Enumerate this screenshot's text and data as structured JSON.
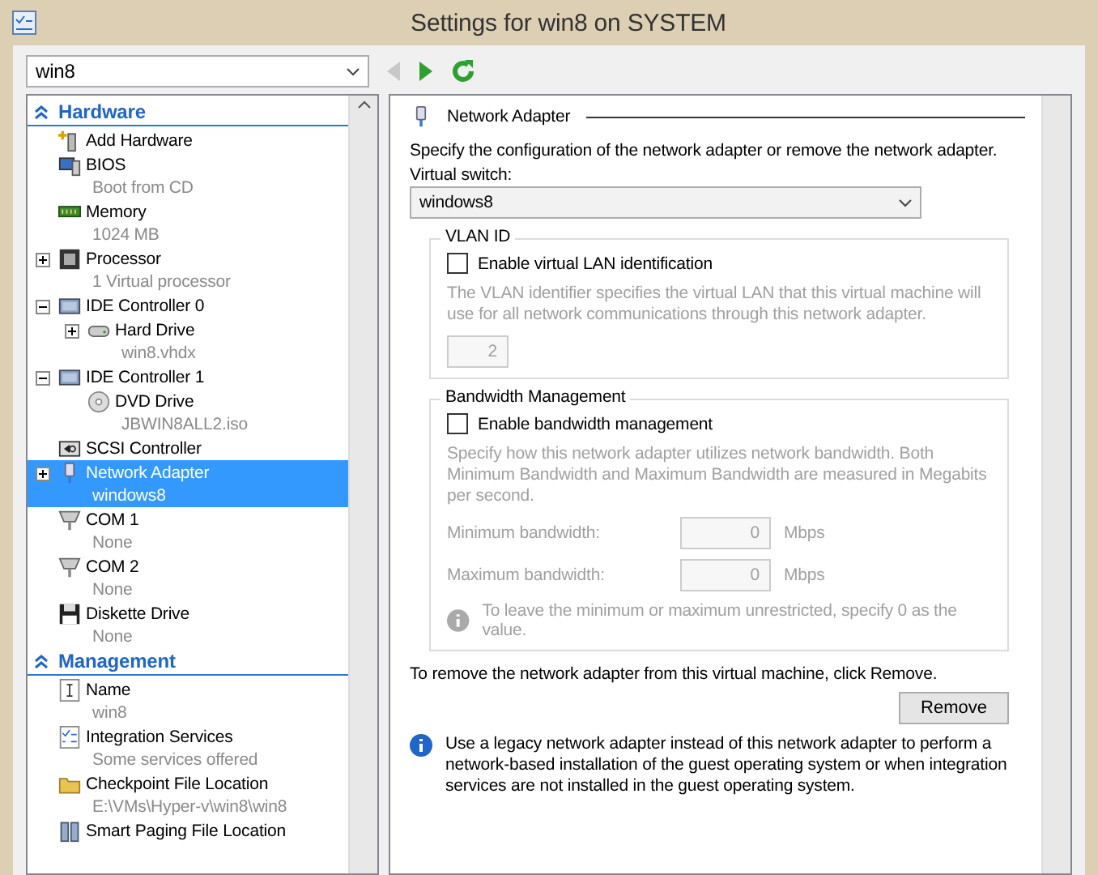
{
  "window": {
    "title": "Settings for win8 on SYSTEM"
  },
  "vm_selector": {
    "value": "win8"
  },
  "navigation": {
    "back": {
      "disabled": true
    },
    "forward": {
      "disabled": false
    }
  },
  "tree": {
    "sections": [
      {
        "title": "Hardware",
        "expanded": true,
        "items": [
          {
            "kind": "add",
            "name": "Add Hardware",
            "selected": false
          },
          {
            "kind": "bios",
            "name": "BIOS",
            "sub": "Boot from CD",
            "selected": false
          },
          {
            "kind": "memory",
            "name": "Memory",
            "sub": "1024 MB",
            "selected": false
          },
          {
            "kind": "processor",
            "name": "Processor",
            "sub": "1 Virtual processor",
            "expanded": false,
            "selected": false
          },
          {
            "kind": "controller",
            "name": "IDE Controller 0",
            "expanded": true,
            "selected": false,
            "children": [
              {
                "kind": "disk",
                "name": "Hard Drive",
                "sub": "win8.vhdx",
                "expanded": false,
                "selected": false
              }
            ]
          },
          {
            "kind": "controller",
            "name": "IDE Controller 1",
            "expanded": true,
            "selected": false,
            "children": [
              {
                "kind": "dvd",
                "name": "DVD Drive",
                "sub": "JBWIN8ALL2.iso",
                "selected": false
              }
            ]
          },
          {
            "kind": "scsi",
            "name": "SCSI Controller",
            "selected": false
          },
          {
            "kind": "network",
            "name": "Network Adapter",
            "sub": "windows8",
            "expanded": false,
            "selected": true
          },
          {
            "kind": "port",
            "name": "COM 1",
            "sub": "None",
            "selected": false
          },
          {
            "kind": "port",
            "name": "COM 2",
            "sub": "None",
            "selected": false
          },
          {
            "kind": "floppy",
            "name": "Diskette Drive",
            "sub": "None",
            "selected": false
          }
        ]
      },
      {
        "title": "Management",
        "expanded": true,
        "items": [
          {
            "kind": "name",
            "name": "Name",
            "sub": "win8",
            "selected": false
          },
          {
            "kind": "services",
            "name": "Integration Services",
            "sub": "Some services offered",
            "selected": false
          },
          {
            "kind": "folder",
            "name": "Checkpoint File Location",
            "sub": "E:\\VMs\\Hyper-v\\win8\\win8",
            "selected": false
          },
          {
            "kind": "paging",
            "name": "Smart Paging File Location",
            "selected": false
          }
        ]
      }
    ]
  },
  "panel": {
    "heading": "Network Adapter",
    "description": "Specify the configuration of the network adapter or remove the network adapter.",
    "virtual_switch": {
      "label": "Virtual switch:",
      "value": "windows8"
    },
    "vlan": {
      "title": "VLAN ID",
      "checkbox": {
        "label": "Enable virtual LAN identification",
        "checked": false
      },
      "disabled": true,
      "help": "The VLAN identifier specifies the virtual LAN that this virtual machine will use for all network communications through this network adapter.",
      "value": "2"
    },
    "bandwidth": {
      "title": "Bandwidth Management",
      "checkbox": {
        "label": "Enable bandwidth management",
        "checked": false
      },
      "disabled": true,
      "help": "Specify how this network adapter utilizes network bandwidth. Both Minimum Bandwidth and Maximum Bandwidth are measured in Megabits per second.",
      "fields": [
        {
          "label": "Minimum bandwidth:",
          "value": "0",
          "unit": "Mbps"
        },
        {
          "label": "Maximum bandwidth:",
          "value": "0",
          "unit": "Mbps"
        }
      ],
      "note": "To leave the minimum or maximum unrestricted, specify 0 as the value."
    },
    "remove_text": "To remove the network adapter from this virtual machine, click Remove.",
    "remove_button": "Remove",
    "info": "Use a legacy network adapter instead of this network adapter to perform a network-based installation of the guest operating system or when integration services are not installed in the guest operating system."
  }
}
